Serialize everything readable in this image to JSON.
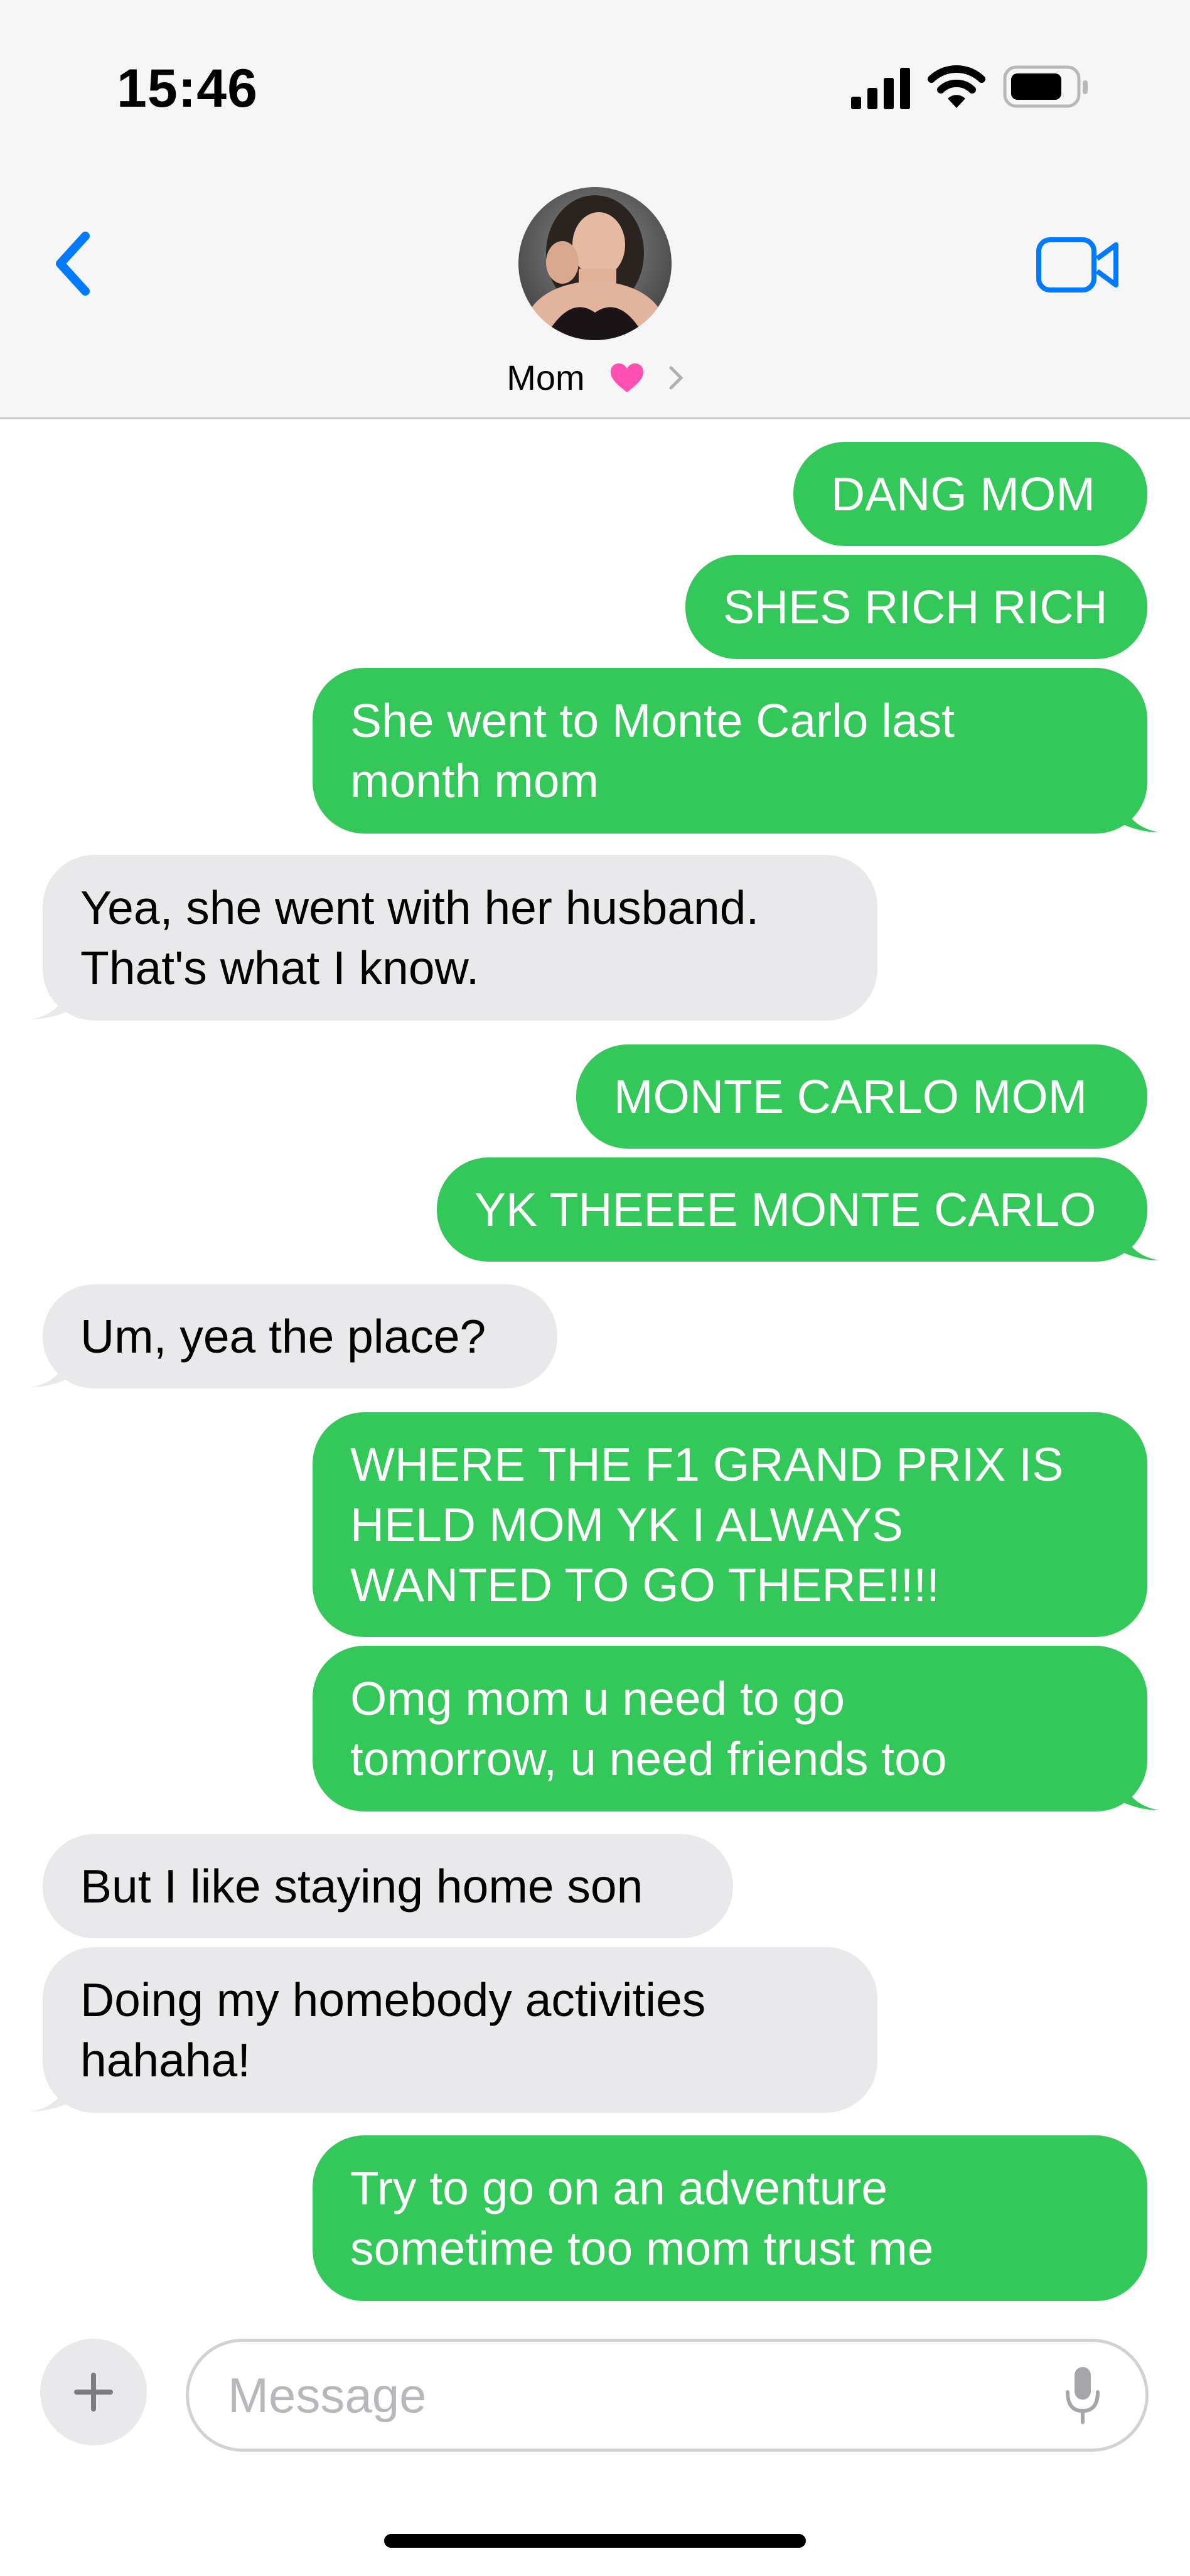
{
  "status_bar": {
    "time": "15:46"
  },
  "header": {
    "contact_name": "Mom"
  },
  "messages": [
    {
      "dir": "out",
      "lines": [
        "DANG MOM"
      ]
    },
    {
      "dir": "out",
      "lines": [
        "SHES RICH RICH"
      ]
    },
    {
      "dir": "out",
      "lines": [
        "She went to Monte Carlo last",
        "month mom"
      ]
    },
    {
      "dir": "in",
      "lines": [
        "Yea, she went with her husband.",
        "That's what I know."
      ]
    },
    {
      "dir": "out",
      "lines": [
        "MONTE CARLO MOM"
      ]
    },
    {
      "dir": "out",
      "lines": [
        "YK THEEEE MONTE CARLO"
      ]
    },
    {
      "dir": "in",
      "lines": [
        "Um, yea the place?"
      ]
    },
    {
      "dir": "out",
      "lines": [
        "WHERE THE F1 GRAND PRIX IS",
        "HELD MOM YK I ALWAYS",
        "WANTED TO GO THERE!!!!"
      ]
    },
    {
      "dir": "out",
      "lines": [
        "Omg mom u need to go",
        "tomorrow, u need friends too"
      ]
    },
    {
      "dir": "in",
      "lines": [
        "But I like staying home son"
      ]
    },
    {
      "dir": "in",
      "lines": [
        "Doing my homebody activities",
        "hahaha!"
      ]
    },
    {
      "dir": "out",
      "lines": [
        "Try to go on an adventure",
        "sometime too mom trust me"
      ]
    }
  ],
  "compose": {
    "placeholder": "Message"
  },
  "colors": {
    "outgoing": "#34c759",
    "incoming": "#e9e9eb",
    "accent": "#007aff",
    "heart": "#ff4fb3"
  },
  "icons": [
    "back-chevron-icon",
    "video-camera-icon",
    "heart-icon",
    "chevron-right-icon",
    "plus-icon",
    "microphone-icon",
    "signal-icon",
    "wifi-icon",
    "battery-icon"
  ]
}
